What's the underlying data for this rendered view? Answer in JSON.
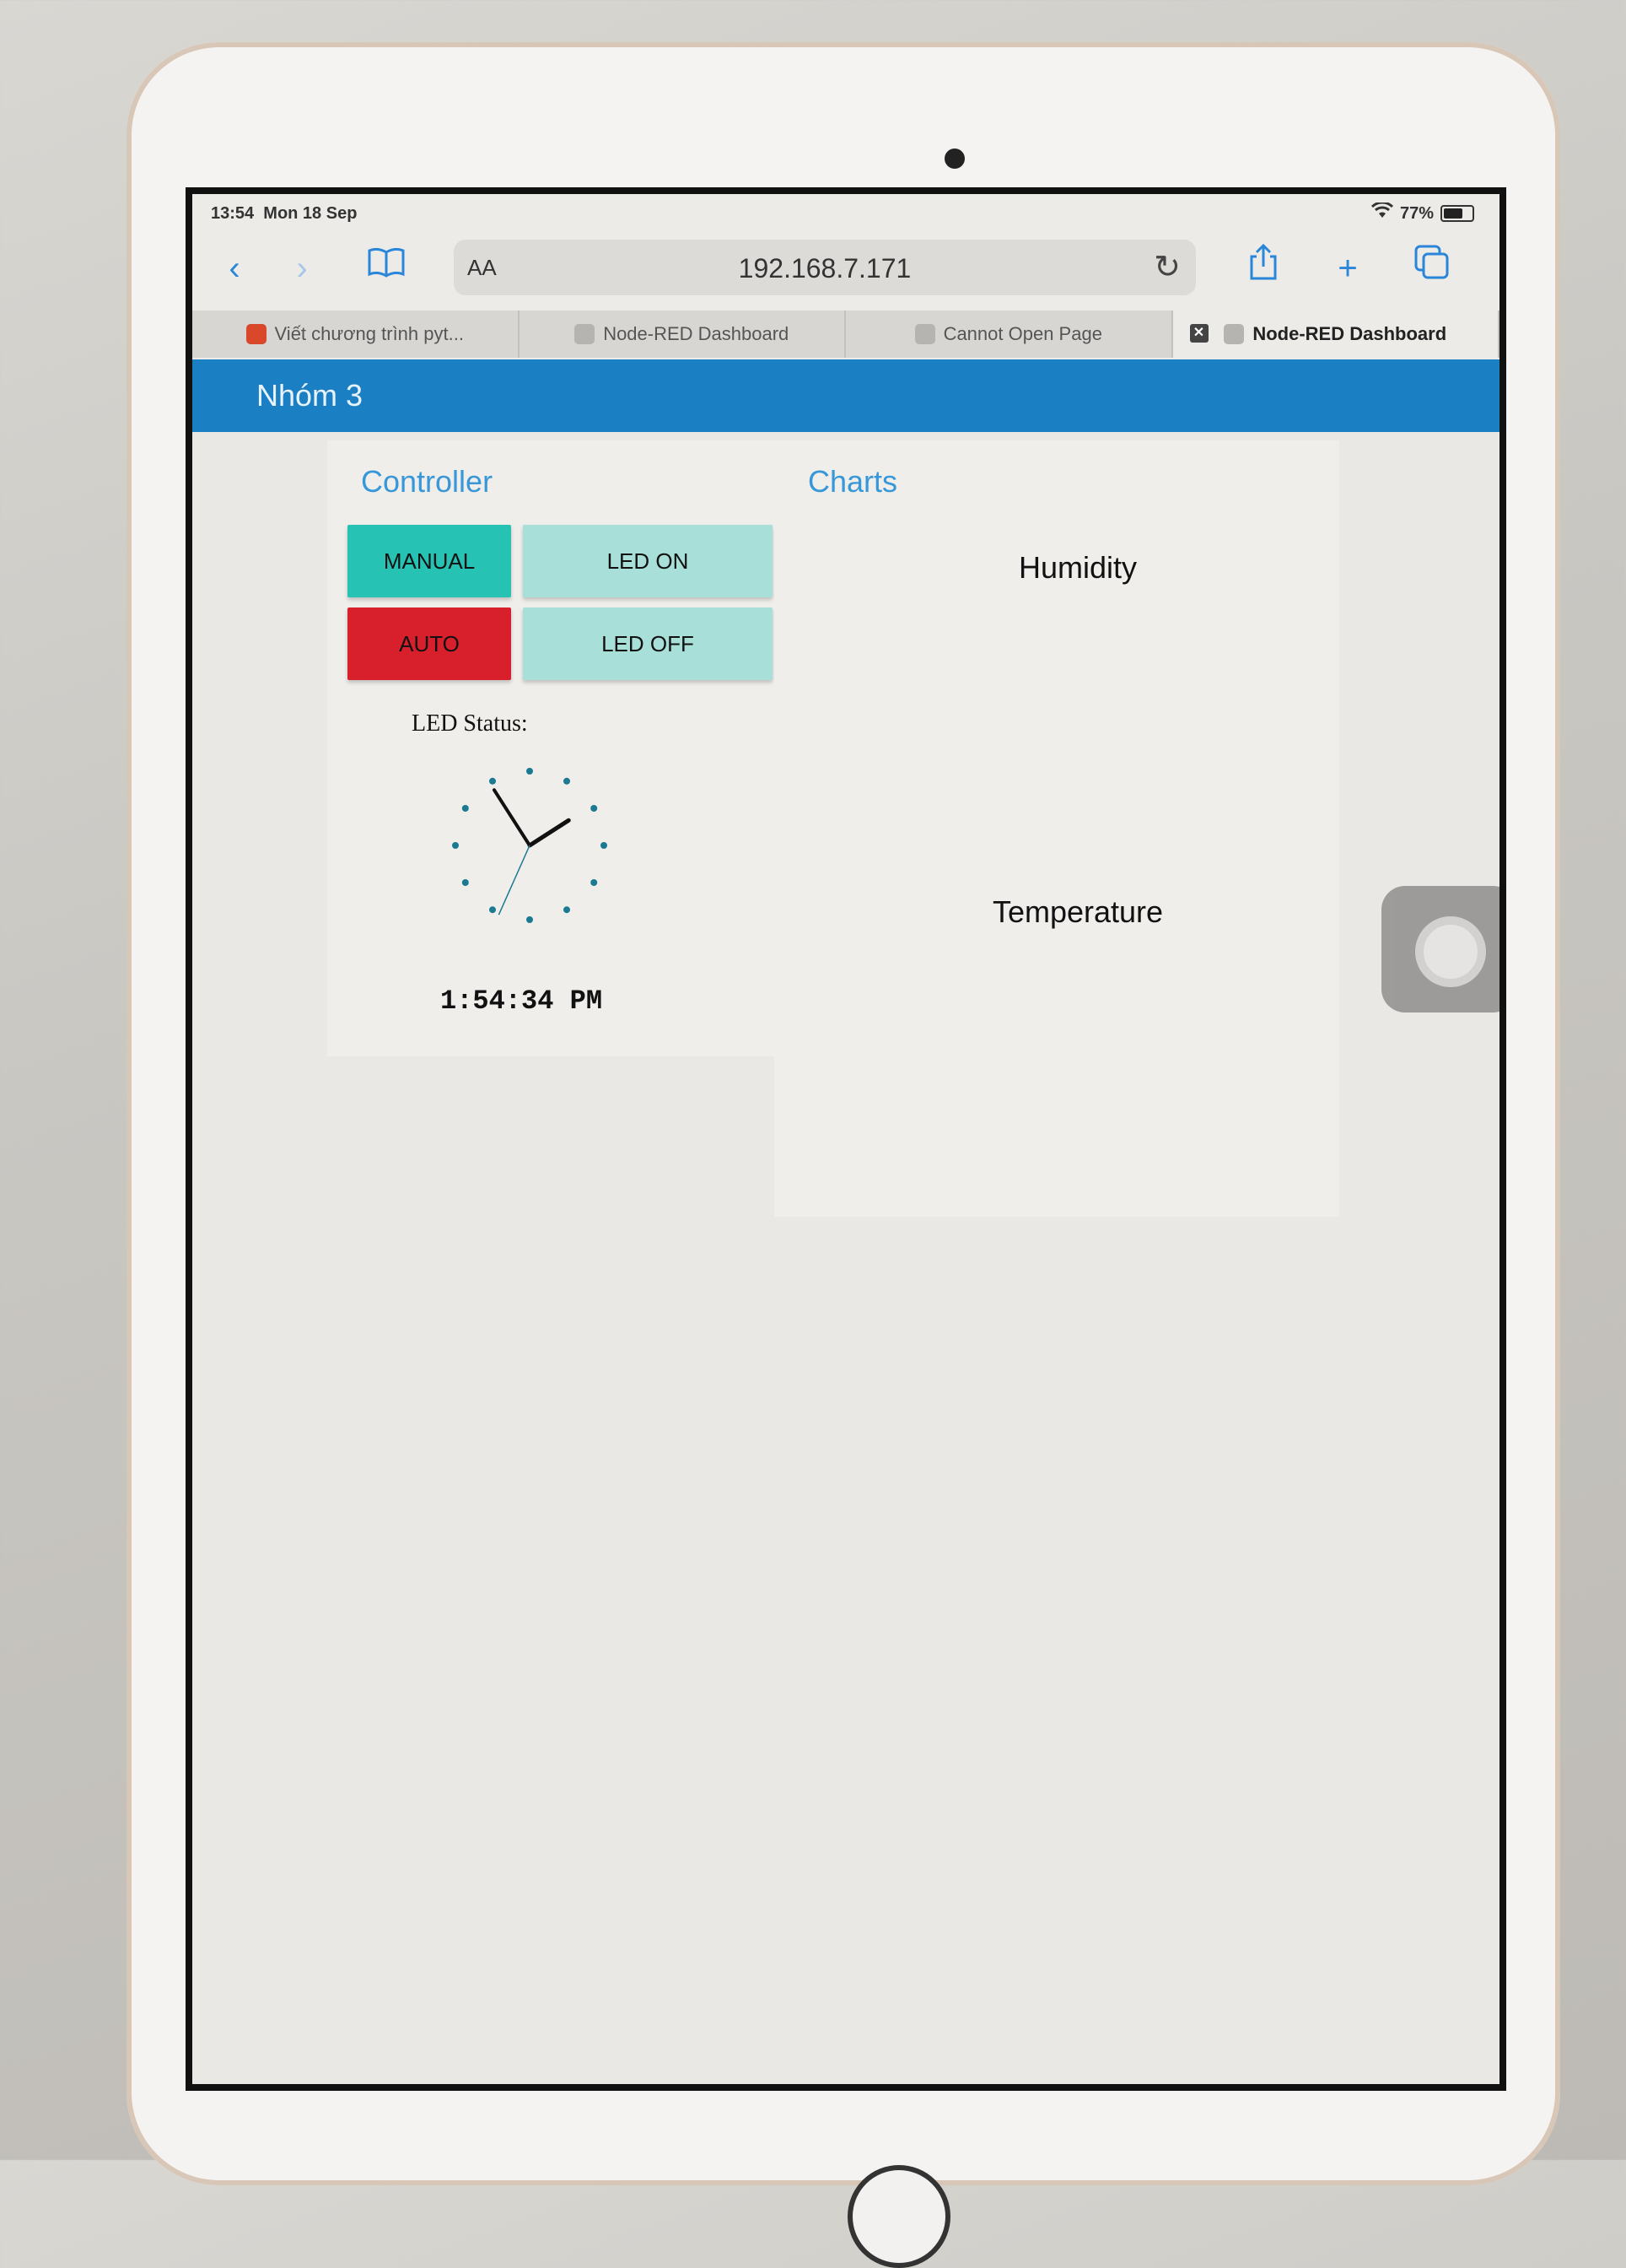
{
  "status_bar": {
    "time": "13:54",
    "date": "Mon 18 Sep",
    "battery": "77%",
    "battery_level": 0.77
  },
  "browser": {
    "text_size_label": "AA",
    "url": "192.168.7.171",
    "tabs": [
      {
        "title": "Viết chương trình pyt...",
        "active": false
      },
      {
        "title": "Node-RED Dashboard",
        "active": false
      },
      {
        "title": "Cannot Open Page",
        "active": false
      },
      {
        "title": "Node-RED Dashboard",
        "active": true
      }
    ]
  },
  "dashboard": {
    "title": "Nhóm 3",
    "controller": {
      "title": "Controller",
      "manual_label": "MANUAL",
      "led_on_label": "LED ON",
      "auto_label": "AUTO",
      "led_off_label": "LED OFF",
      "led_status_label": "LED Status:",
      "digital_time": "1:54:34 PM",
      "clock_time": {
        "hours": 13,
        "minutes": 54,
        "seconds": 34
      }
    },
    "charts": {
      "title": "Charts",
      "humidity_label": "Humidity",
      "temperature_label": "Temperature"
    }
  },
  "colors": {
    "header": "#1b7fc3",
    "group_title": "#3797d8",
    "manual_button": "#26c2b3",
    "auto_button": "#d81f2c",
    "led_button": "#a8dfd8",
    "clock_accent": "#1b7a92"
  }
}
